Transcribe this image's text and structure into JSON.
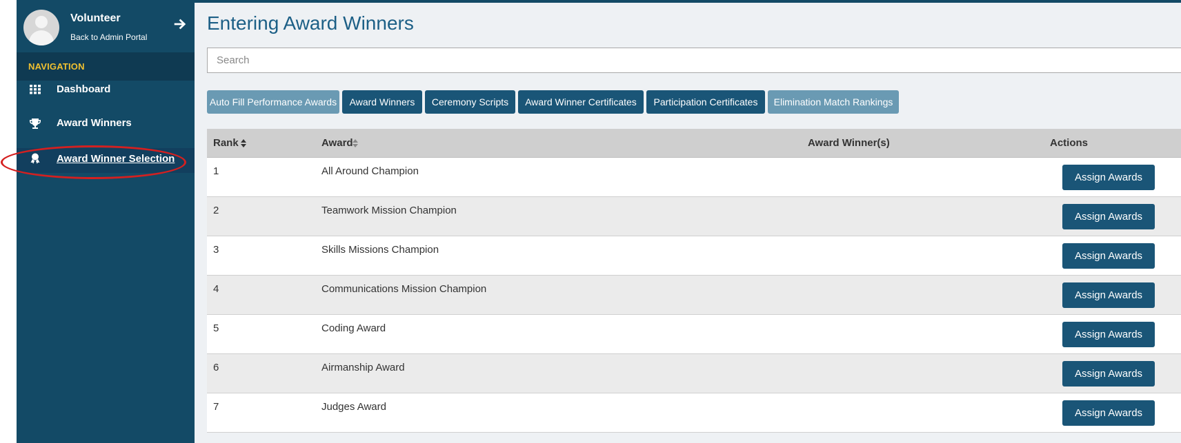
{
  "profile": {
    "name": "Volunteer",
    "subtitle": "Back to Admin Portal",
    "icons": {
      "avatar": "user-avatar",
      "back": "arrow-right-icon"
    }
  },
  "nav": {
    "header": "NAVIGATION",
    "items": [
      {
        "label": "Dashboard",
        "icon": "grid-icon"
      },
      {
        "label": "Award Winners",
        "icon": "trophy-icon"
      },
      {
        "label": "Award Winner Selection",
        "icon": "award-ribbon-icon",
        "active": true
      }
    ]
  },
  "page": {
    "title": "Entering Award Winners",
    "search_placeholder": "Search"
  },
  "toolbar": {
    "buttons": [
      {
        "label": "Auto Fill Performance Awards",
        "style": "light"
      },
      {
        "label": "Award Winners",
        "style": "dark"
      },
      {
        "label": "Ceremony Scripts",
        "style": "dark"
      },
      {
        "label": "Award Winner Certificates",
        "style": "dark"
      },
      {
        "label": "Participation Certificates",
        "style": "dark"
      },
      {
        "label": "Elimination Match Rankings",
        "style": "light"
      }
    ]
  },
  "table": {
    "columns": {
      "rank": "Rank",
      "award": "Award",
      "winners": "Award Winner(s)",
      "actions": "Actions"
    },
    "action_label": "Assign Awards",
    "rows": [
      {
        "rank": "1",
        "award": "All Around Champion",
        "winners": ""
      },
      {
        "rank": "2",
        "award": "Teamwork Mission Champion",
        "winners": ""
      },
      {
        "rank": "3",
        "award": "Skills Missions Champion",
        "winners": ""
      },
      {
        "rank": "4",
        "award": "Communications Mission Champion",
        "winners": ""
      },
      {
        "rank": "5",
        "award": "Coding Award",
        "winners": ""
      },
      {
        "rank": "6",
        "award": "Airmanship Award",
        "winners": ""
      },
      {
        "rank": "7",
        "award": "Judges Award",
        "winners": ""
      }
    ]
  },
  "colors": {
    "sidebar": "#134a66",
    "nav_header_text": "#f0c030",
    "primary_button": "#1a5577",
    "secondary_button": "#6a9ab3",
    "title": "#1c5f86",
    "annotation_circle": "#d42020"
  }
}
